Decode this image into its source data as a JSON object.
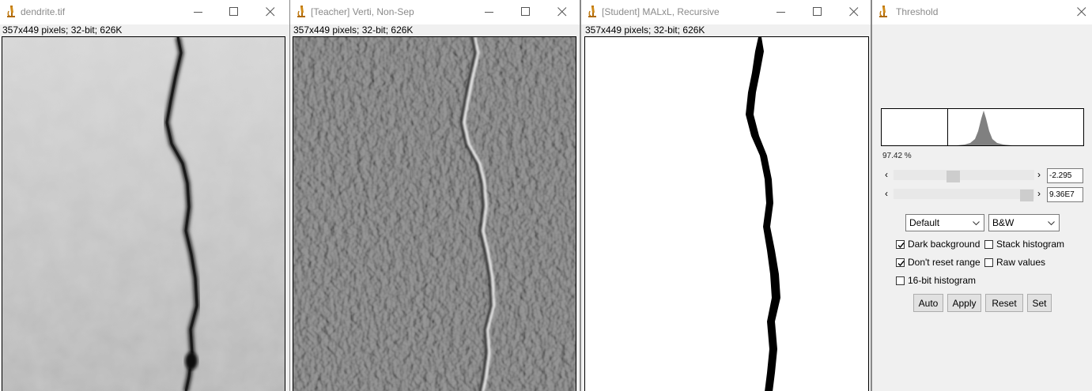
{
  "windows": [
    {
      "title": "dendrite.tif",
      "info": "357x449 pixels; 32-bit; 626K"
    },
    {
      "title": "[Teacher] Verti, Non-Sep",
      "info": "357x449 pixels; 32-bit; 626K"
    },
    {
      "title": "[Student] MALxL, Recursive",
      "info": "357x449 pixels; 32-bit; 626K"
    }
  ],
  "threshold": {
    "title": "Threshold",
    "percent": "97.42 %",
    "lower_value": "-2.295",
    "upper_value": "9.36E7",
    "method": "Default",
    "mode": "B&W",
    "dark_background": "Dark background",
    "stack_histogram": "Stack histogram",
    "dont_reset_range": "Don't reset range",
    "raw_values": "Raw values",
    "bit16_histogram": "16-bit histogram",
    "buttons": {
      "auto": "Auto",
      "apply": "Apply",
      "reset": "Reset",
      "set": "Set"
    },
    "checked": {
      "dark_background": true,
      "stack_histogram": false,
      "dont_reset_range": true,
      "raw_values": false,
      "bit16_histogram": false
    }
  },
  "icons": {
    "app": "imagej-microscope-icon",
    "minimize": "minimize-icon",
    "maximize": "maximize-icon",
    "close": "close-icon"
  }
}
